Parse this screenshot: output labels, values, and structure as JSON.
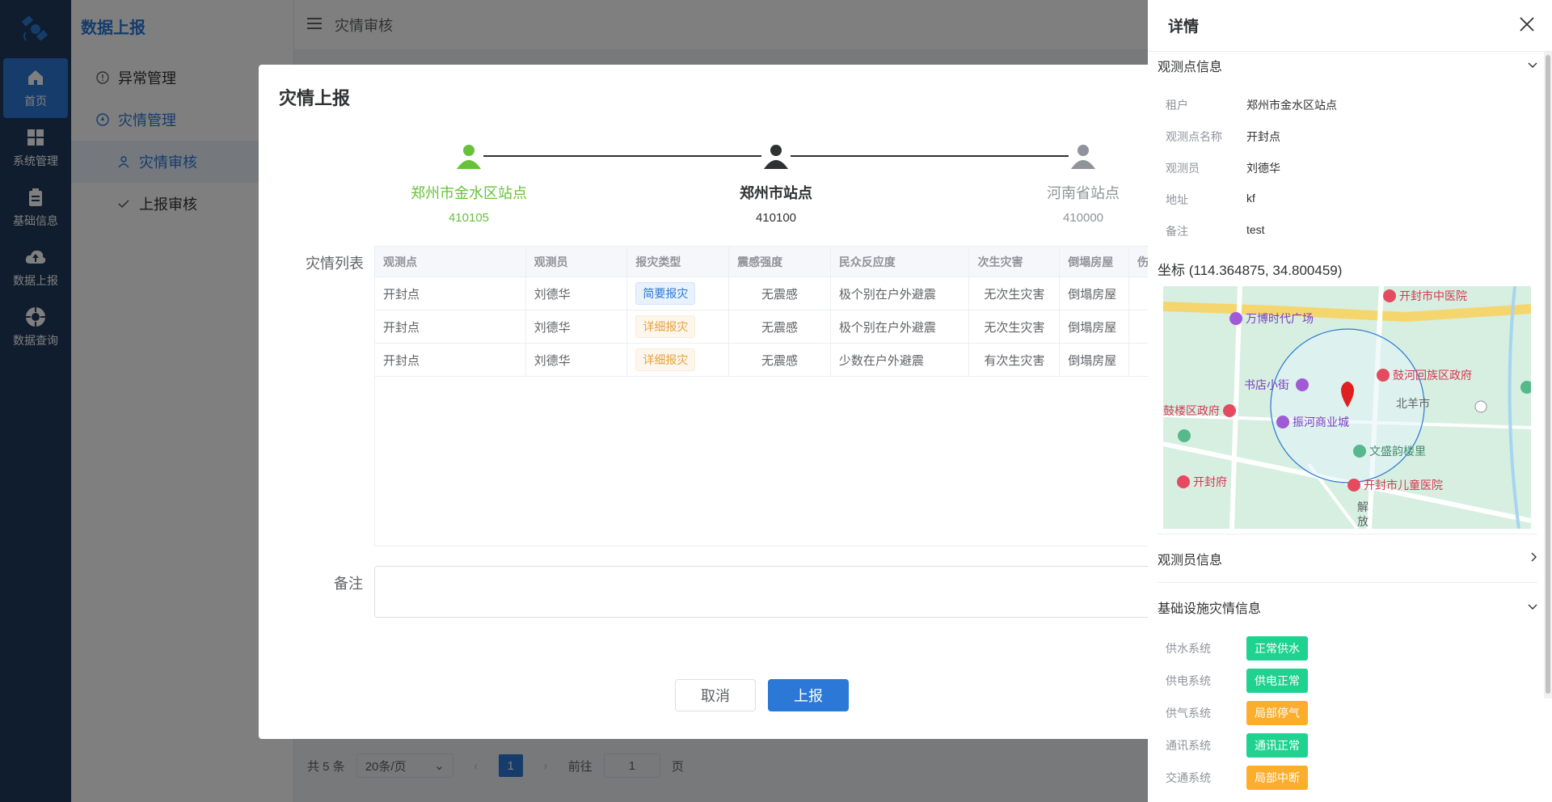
{
  "rail": {
    "items": [
      {
        "label": "首页",
        "icon": "home-icon"
      },
      {
        "label": "系统管理",
        "icon": "grid-icon"
      },
      {
        "label": "基础信息",
        "icon": "clipboard-icon"
      },
      {
        "label": "数据上报",
        "icon": "cloud-upload-icon"
      },
      {
        "label": "数据查询",
        "icon": "compass-icon"
      }
    ]
  },
  "submenu": {
    "title": "数据上报",
    "items": [
      {
        "label": "异常管理"
      },
      {
        "label": "灾情管理"
      },
      {
        "label": "灾情审核"
      },
      {
        "label": "上报审核"
      }
    ]
  },
  "topbar": {
    "title": "灾情审核"
  },
  "pager": {
    "total": "共 5 条",
    "page_size": "20条/页",
    "current": "1",
    "goto_label": "前往",
    "goto_value": "1",
    "page_unit": "页"
  },
  "dialog": {
    "title": "灾情上报",
    "steps": [
      {
        "name": "郑州市金水区站点",
        "code": "410105"
      },
      {
        "name": "郑州市站点",
        "code": "410100"
      },
      {
        "name": "河南省站点",
        "code": "410000"
      }
    ],
    "list_label": "灾情列表",
    "table": {
      "headers": [
        "观测点",
        "观测员",
        "报灾类型",
        "震感强度",
        "民众反应度",
        "次生灾害",
        "倒塌房屋",
        "伤"
      ],
      "rows": [
        [
          "开封点",
          "刘德华",
          "简要报灾",
          "无震感",
          "极个别在户外避震",
          "无次生灾害",
          "倒塌房屋"
        ],
        [
          "开封点",
          "刘德华",
          "详细报灾",
          "无震感",
          "极个别在户外避震",
          "无次生灾害",
          "倒塌房屋"
        ],
        [
          "开封点",
          "刘德华",
          "详细报灾",
          "无震感",
          "少数在户外避震",
          "有次生灾害",
          "倒塌房屋"
        ]
      ]
    },
    "note_label": "备注",
    "cancel_label": "取消",
    "submit_label": "上报"
  },
  "drawer": {
    "title": "详情",
    "point_section": "观测点信息",
    "fields": [
      {
        "k": "租户",
        "v": "郑州市金水区站点"
      },
      {
        "k": "观测点名称",
        "v": "开封点"
      },
      {
        "k": "观测员",
        "v": "刘德华"
      },
      {
        "k": "地址",
        "v": "kf"
      },
      {
        "k": "备注",
        "v": "test"
      }
    ],
    "coord": "坐标 (114.364875, 34.800459)",
    "map_labels": [
      "开封市中医院",
      "万博时代广场",
      "书店小街",
      "鼓楼区政府",
      "振河商业城",
      "鼓河回族区政府",
      "北羊市",
      "文盛韵楼里",
      "开封府",
      "开封市儿童医院",
      "解",
      "放"
    ],
    "observer_section": "观测员信息",
    "infra_section": "基础设施灾情信息",
    "infra": [
      {
        "k": "供水系统",
        "v": "正常供水",
        "color": "#1fd28f"
      },
      {
        "k": "供电系统",
        "v": "供电正常",
        "color": "#1fd28f"
      },
      {
        "k": "供气系统",
        "v": "局部停气",
        "color": "#fbad2c"
      },
      {
        "k": "通讯系统",
        "v": "通讯正常",
        "color": "#1fd28f"
      },
      {
        "k": "交通系统",
        "v": "局部中断",
        "color": "#fbad2c"
      }
    ]
  }
}
